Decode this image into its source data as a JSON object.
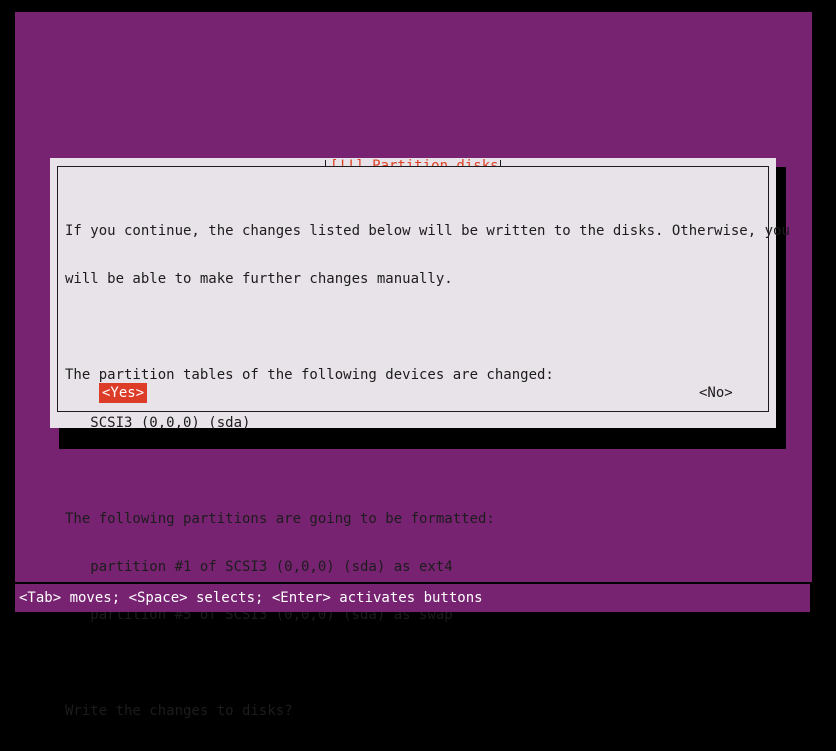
{
  "screen": {
    "background_color": "#772372",
    "frame_color": "#000000"
  },
  "dialog": {
    "title": "[!!] Partition disks",
    "title_color": "#dd3f23",
    "background_color": "#e8e3e8",
    "text_color": "#1c1c1c",
    "paragraphs": {
      "intro_line1": "If you continue, the changes listed below will be written to the disks. Otherwise, you",
      "intro_line2": "will be able to make further changes manually.",
      "tables_heading": "The partition tables of the following devices are changed:",
      "tables_item1": "   SCSI3 (0,0,0) (sda)",
      "format_heading": "The following partitions are going to be formatted:",
      "format_item1": "   partition #1 of SCSI3 (0,0,0) (sda) as ext4",
      "format_item2": "   partition #5 of SCSI3 (0,0,0) (sda) as swap",
      "question": "Write the changes to disks?"
    },
    "buttons": {
      "yes": {
        "label": "<Yes>",
        "selected": true,
        "highlight_color": "#dc3c28",
        "text_color": "#ffffff"
      },
      "no": {
        "label": "<No>",
        "selected": false,
        "text_color": "#1c1c1c"
      }
    }
  },
  "help_bar": {
    "text": "<Tab> moves; <Space> selects; <Enter> activates buttons",
    "text_color": "#ffffff",
    "background_color": "#772372"
  }
}
